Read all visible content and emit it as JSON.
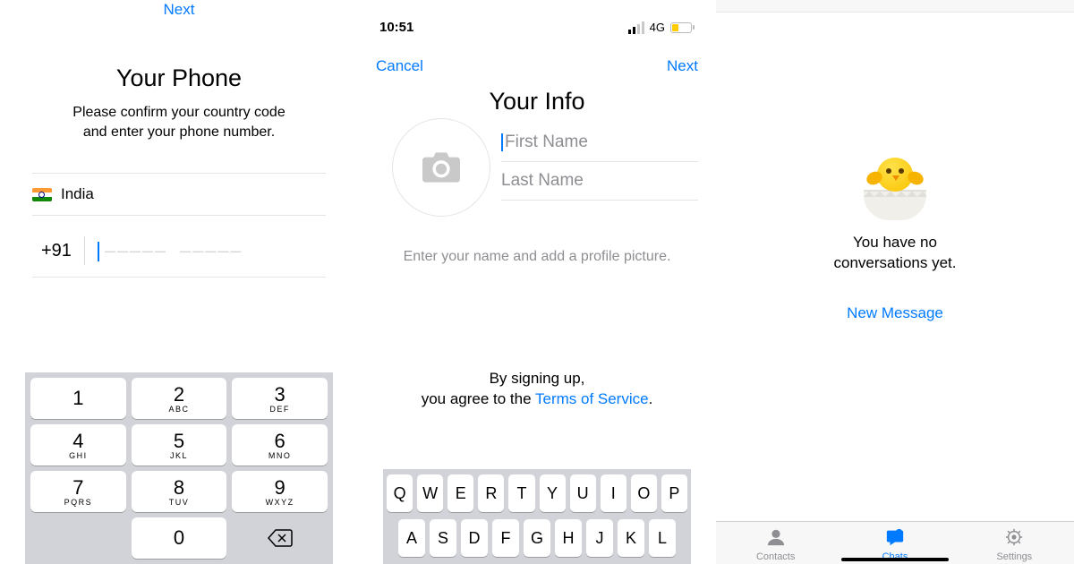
{
  "pane1": {
    "next": "Next",
    "title": "Your Phone",
    "subtitle_l1": "Please confirm your country code",
    "subtitle_l2": "and enter your phone number.",
    "country": "India",
    "dial_code": "+91",
    "placeholder": "––––– –––––",
    "keypad": [
      {
        "d": "1",
        "s": ""
      },
      {
        "d": "2",
        "s": "ABC"
      },
      {
        "d": "3",
        "s": "DEF"
      },
      {
        "d": "4",
        "s": "GHI"
      },
      {
        "d": "5",
        "s": "JKL"
      },
      {
        "d": "6",
        "s": "MNO"
      },
      {
        "d": "7",
        "s": "PQRS"
      },
      {
        "d": "8",
        "s": "TUV"
      },
      {
        "d": "9",
        "s": "WXYZ"
      },
      {
        "d": "0",
        "s": ""
      }
    ]
  },
  "pane2": {
    "time": "10:51",
    "network": "4G",
    "cancel": "Cancel",
    "next": "Next",
    "title": "Your Info",
    "first_name_ph": "First Name",
    "last_name_ph": "Last Name",
    "hint": "Enter your name and add a profile picture.",
    "tos_l1": "By signing up,",
    "tos_l2a": "you agree to the ",
    "tos_link": "Terms of Service",
    "tos_l2b": ".",
    "row1": [
      "Q",
      "W",
      "E",
      "R",
      "T",
      "Y",
      "U",
      "I",
      "O",
      "P"
    ],
    "row2": [
      "A",
      "S",
      "D",
      "F",
      "G",
      "H",
      "J",
      "K",
      "L"
    ]
  },
  "pane3": {
    "empty_l1": "You have no",
    "empty_l2": "conversations yet.",
    "new_message": "New Message",
    "tabs": [
      "Contacts",
      "Chats",
      "Settings"
    ],
    "active_tab": 1
  }
}
